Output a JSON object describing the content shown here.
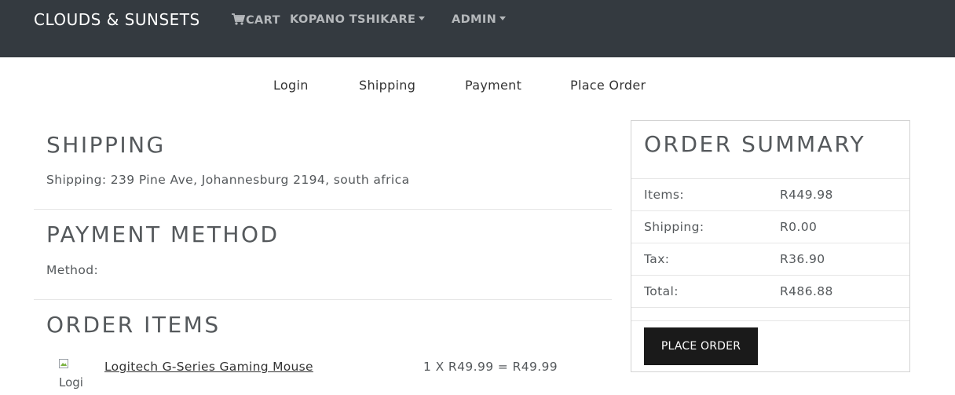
{
  "navbar": {
    "brand": "CLOUDS & SUNSETS",
    "cart": "CART",
    "user": "KOPANO TSHIKARE",
    "admin": "ADMIN"
  },
  "steps": [
    "Login",
    "Shipping",
    "Payment",
    "Place Order"
  ],
  "shipping": {
    "title": "SHIPPING",
    "address": "Shipping: 239 Pine Ave, Johannesburg 2194, south africa"
  },
  "payment": {
    "title": "PAYMENT METHOD",
    "method": "Method:"
  },
  "order_items": {
    "title": "ORDER ITEMS",
    "items": [
      {
        "image_alt": "Logi",
        "name": "Logitech G-Series Gaming Mouse",
        "calc": "1 X R49.99 = R49.99"
      }
    ]
  },
  "summary": {
    "title": "ORDER SUMMARY",
    "rows": [
      {
        "label": "Items:",
        "value": "R449.98"
      },
      {
        "label": "Shipping:",
        "value": "R0.00"
      },
      {
        "label": "Tax:",
        "value": "R36.90"
      },
      {
        "label": "Total:",
        "value": "R486.88"
      }
    ],
    "button": "PLACE ORDER"
  },
  "icons": {
    "cart": "shopping-cart-icon",
    "dropdown": "caret-down-icon"
  }
}
